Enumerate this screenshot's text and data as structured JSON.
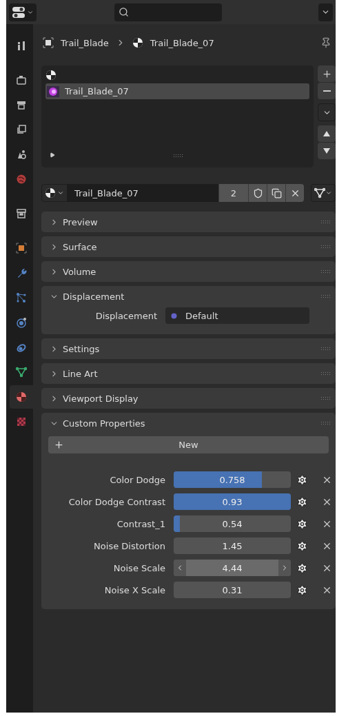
{
  "breadcrumb": [
    {
      "kind": "object",
      "label": "Trail_Blade"
    },
    {
      "kind": "material",
      "label": "Trail_Blade_07"
    }
  ],
  "sidebar": [
    {
      "kind": "tool",
      "selected": false
    },
    {
      "kind": "render",
      "selected": false
    },
    {
      "kind": "output",
      "selected": false
    },
    {
      "kind": "view_layer",
      "selected": false
    },
    {
      "kind": "scene",
      "selected": false
    },
    {
      "kind": "world",
      "selected": false
    },
    {
      "kind": "collection",
      "selected": false
    },
    {
      "kind": "object",
      "selected": false
    },
    {
      "kind": "modifier",
      "selected": false
    },
    {
      "kind": "particles",
      "selected": false
    },
    {
      "kind": "physics",
      "selected": false
    },
    {
      "kind": "constraints",
      "selected": false
    },
    {
      "kind": "data",
      "selected": false
    },
    {
      "kind": "material",
      "selected": true
    },
    {
      "kind": "texture",
      "selected": false
    }
  ],
  "material_slots": [
    {
      "label": "Trail_Blade_07",
      "selected": true
    }
  ],
  "material_id": {
    "name": "Trail_Blade_07",
    "users": "2"
  },
  "panels": [
    {
      "title": "Preview",
      "expanded": false
    },
    {
      "title": "Surface",
      "expanded": false
    },
    {
      "title": "Volume",
      "expanded": false
    },
    {
      "title": "Displacement",
      "expanded": true,
      "field": {
        "label": "Displacement",
        "value": "Default"
      }
    },
    {
      "title": "Settings",
      "expanded": false
    },
    {
      "title": "Line Art",
      "expanded": false
    },
    {
      "title": "Viewport Display",
      "expanded": false
    },
    {
      "title": "Custom Properties",
      "expanded": true,
      "new_button": "New",
      "properties": [
        {
          "label": "Color Dodge",
          "value": "0.758",
          "kind": "slider",
          "level": 0.75,
          "hovered": false
        },
        {
          "label": "Color Dodge Contrast",
          "value": "0.93",
          "kind": "slider",
          "level": 1,
          "hovered": false
        },
        {
          "label": "Contrast_1",
          "value": "0.54",
          "kind": "slider",
          "level": 0.05,
          "hovered": false
        },
        {
          "label": "Noise Distortion",
          "value": "1.45",
          "kind": "number",
          "hovered": false
        },
        {
          "label": "Noise Scale",
          "value": "4.44",
          "kind": "number",
          "hovered": true
        },
        {
          "label": "Noise X Scale",
          "value": "0.31",
          "kind": "number",
          "hovered": false
        }
      ]
    }
  ]
}
